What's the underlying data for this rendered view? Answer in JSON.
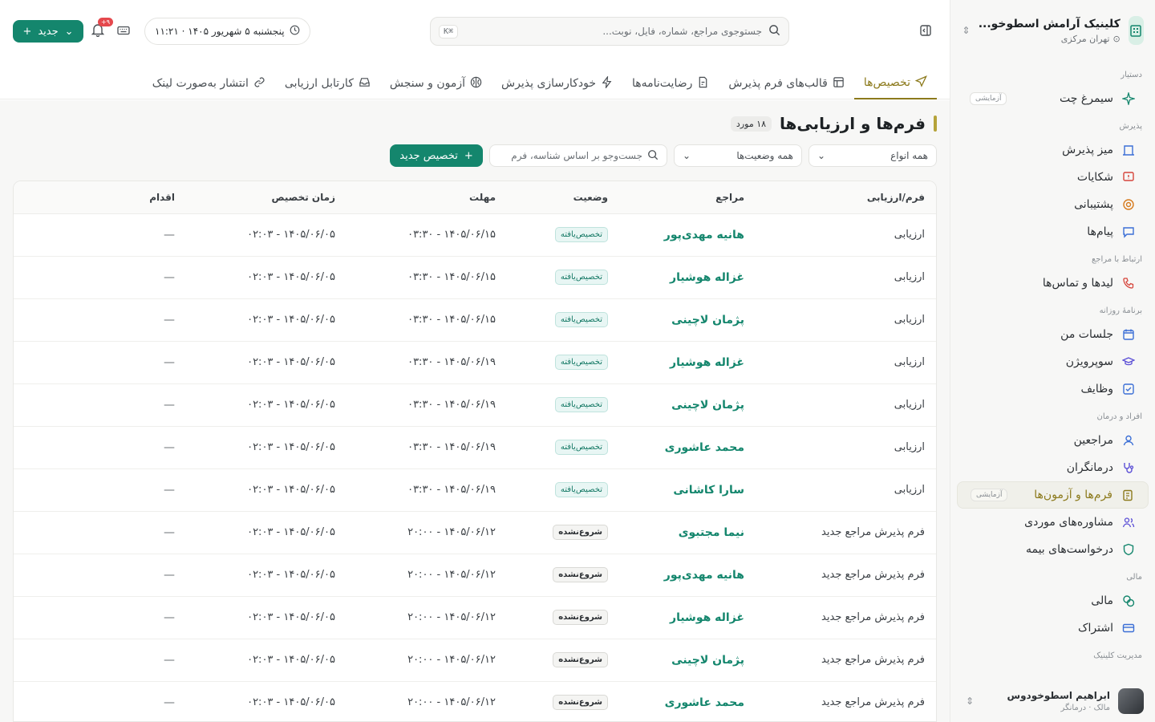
{
  "sidebar": {
    "clinic_name": "کلینیک آرامش اسطوخو...",
    "clinic_location": "تهران مرکزی",
    "sections": {
      "assistant": "دستیار",
      "reception": "پذیرش",
      "client_comm": "ارتباط با مراجع",
      "daily": "برنامهٔ روزانه",
      "people": "افراد و درمان",
      "finance": "مالی",
      "management": "مدیریت کلینیک"
    },
    "items": {
      "simorgh": "سیمرغ چت",
      "simorgh_tag": "آزمایشی",
      "reception_desk": "میز پذیرش",
      "complaints": "شکایات",
      "support": "پشتیبانی",
      "messages": "پیام‌ها",
      "leads": "لیدها و تماس‌ها",
      "my_sessions": "جلسات من",
      "supervision": "سوپرویژن",
      "tasks": "وظایف",
      "clients": "مراجعین",
      "therapists": "درمانگران",
      "forms": "فرم‌ها و آزمون‌ها",
      "forms_tag": "آزمایشی",
      "case_consults": "مشاوره‌های موردی",
      "insurance": "درخواست‌های بیمه",
      "finance": "مالی",
      "subscription": "اشتراک"
    },
    "user": {
      "name": "ابراهیم اسطوخودوس",
      "role": "مالک · درمانگر"
    }
  },
  "topbar": {
    "search_placeholder": "جستوجوی مراجع، شماره، فایل، نوبت...",
    "search_shortcut": "⌘K",
    "date": "پنجشنبه ۵ شهریور ۱۴۰۵ · ۱۱:۲۱",
    "notif_badge": "۹+",
    "new_label": "جدید"
  },
  "tabs": [
    "تخصیص‌ها",
    "قالب‌های فرم پذیرش",
    "رضایت‌نامه‌ها",
    "خودکارسازی پذیرش",
    "آزمون و سنجش",
    "کارتابل ارزیابی",
    "انتشار به‌صورت لینک"
  ],
  "page": {
    "title": "فرم‌ها و ارزیابی‌ها",
    "count": "۱۸ مورد",
    "filter_type": "همه انواع",
    "filter_status": "همه وضعیت‌ها",
    "search_placeholder": "جست‌وجو بر اساس شناسه، فرم",
    "assign_button": "تخصیص جدید"
  },
  "table": {
    "headers": [
      "فرم/ارزیابی",
      "مراجع",
      "وضعیت",
      "مهلت",
      "زمان تخصیص",
      "اقدام"
    ],
    "rows": [
      {
        "form": "ارزیابی",
        "client": "هانیه مهدی‌پور",
        "status": "تخصیص‌یافته",
        "status_type": "assigned",
        "deadline": "۱۴۰۵/۰۶/۱۵ - ۰۳:۳۰",
        "assigned": "۱۴۰۵/۰۶/۰۵ - ۰۲:۰۳",
        "action": "—"
      },
      {
        "form": "ارزیابی",
        "client": "غزاله هوشیار",
        "status": "تخصیص‌یافته",
        "status_type": "assigned",
        "deadline": "۱۴۰۵/۰۶/۱۵ - ۰۳:۳۰",
        "assigned": "۱۴۰۵/۰۶/۰۵ - ۰۲:۰۳",
        "action": "—"
      },
      {
        "form": "ارزیابی",
        "client": "پژمان لاچینی",
        "status": "تخصیص‌یافته",
        "status_type": "assigned",
        "deadline": "۱۴۰۵/۰۶/۱۵ - ۰۳:۳۰",
        "assigned": "۱۴۰۵/۰۶/۰۵ - ۰۲:۰۳",
        "action": "—"
      },
      {
        "form": "ارزیابی",
        "client": "غزاله هوشیار",
        "status": "تخصیص‌یافته",
        "status_type": "assigned",
        "deadline": "۱۴۰۵/۰۶/۱۹ - ۰۳:۳۰",
        "assigned": "۱۴۰۵/۰۶/۰۵ - ۰۲:۰۳",
        "action": "—"
      },
      {
        "form": "ارزیابی",
        "client": "پژمان لاچینی",
        "status": "تخصیص‌یافته",
        "status_type": "assigned",
        "deadline": "۱۴۰۵/۰۶/۱۹ - ۰۳:۳۰",
        "assigned": "۱۴۰۵/۰۶/۰۵ - ۰۲:۰۳",
        "action": "—"
      },
      {
        "form": "ارزیابی",
        "client": "محمد عاشوری",
        "status": "تخصیص‌یافته",
        "status_type": "assigned",
        "deadline": "۱۴۰۵/۰۶/۱۹ - ۰۳:۳۰",
        "assigned": "۱۴۰۵/۰۶/۰۵ - ۰۲:۰۳",
        "action": "—"
      },
      {
        "form": "ارزیابی",
        "client": "سارا کاشانی",
        "status": "تخصیص‌یافته",
        "status_type": "assigned",
        "deadline": "۱۴۰۵/۰۶/۱۹ - ۰۳:۳۰",
        "assigned": "۱۴۰۵/۰۶/۰۵ - ۰۲:۰۳",
        "action": "—"
      },
      {
        "form": "فرم پذیرش مراجع جدید",
        "client": "نیما مجتبوی",
        "status": "شروع‌نشده",
        "status_type": "notstarted",
        "deadline": "۱۴۰۵/۰۶/۱۲ - ۲۰:۰۰",
        "assigned": "۱۴۰۵/۰۶/۰۵ - ۰۲:۰۳",
        "action": "—"
      },
      {
        "form": "فرم پذیرش مراجع جدید",
        "client": "هانیه مهدی‌پور",
        "status": "شروع‌نشده",
        "status_type": "notstarted",
        "deadline": "۱۴۰۵/۰۶/۱۲ - ۲۰:۰۰",
        "assigned": "۱۴۰۵/۰۶/۰۵ - ۰۲:۰۳",
        "action": "—"
      },
      {
        "form": "فرم پذیرش مراجع جدید",
        "client": "غزاله هوشیار",
        "status": "شروع‌نشده",
        "status_type": "notstarted",
        "deadline": "۱۴۰۵/۰۶/۱۲ - ۲۰:۰۰",
        "assigned": "۱۴۰۵/۰۶/۰۵ - ۰۲:۰۳",
        "action": "—"
      },
      {
        "form": "فرم پذیرش مراجع جدید",
        "client": "پژمان لاچینی",
        "status": "شروع‌نشده",
        "status_type": "notstarted",
        "deadline": "۱۴۰۵/۰۶/۱۲ - ۲۰:۰۰",
        "assigned": "۱۴۰۵/۰۶/۰۵ - ۰۲:۰۳",
        "action": "—"
      },
      {
        "form": "فرم پذیرش مراجع جدید",
        "client": "محمد عاشوری",
        "status": "شروع‌نشده",
        "status_type": "notstarted",
        "deadline": "۱۴۰۵/۰۶/۱۲ - ۲۰:۰۰",
        "assigned": "۱۴۰۵/۰۶/۰۵ - ۰۲:۰۳",
        "action": "—"
      }
    ]
  },
  "colors": {
    "accent": "#14866d",
    "active": "#8c7a1c"
  }
}
